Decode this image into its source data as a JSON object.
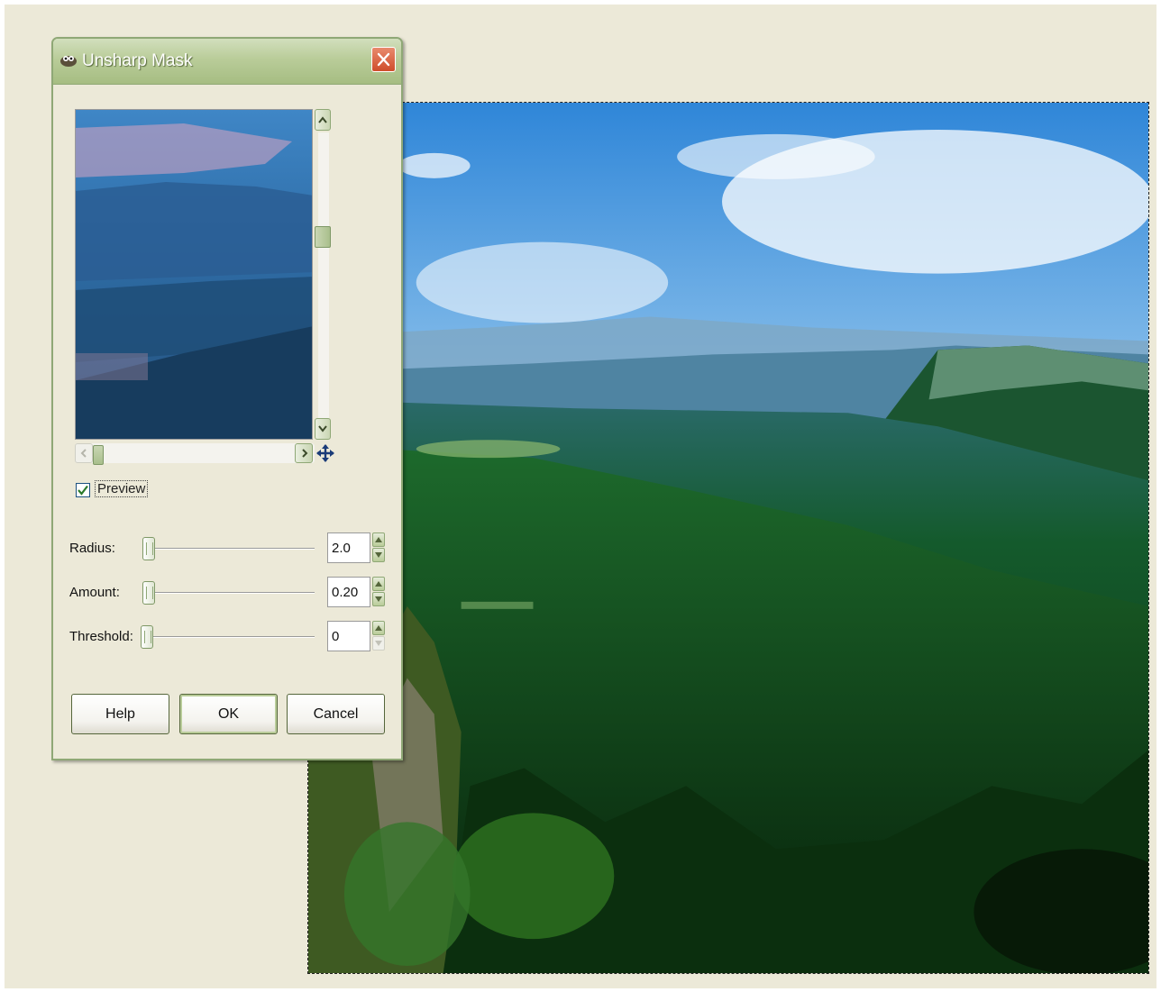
{
  "dialog": {
    "title": "Unsharp Mask",
    "preview_label": "Preview",
    "preview_checked": true
  },
  "params": {
    "radius": {
      "label": "Radius:",
      "value": "2.0"
    },
    "amount": {
      "label": "Amount:",
      "value": "0.20"
    },
    "threshold": {
      "label": "Threshold:",
      "value": "0"
    }
  },
  "buttons": {
    "help": "Help",
    "ok": "OK",
    "cancel": "Cancel"
  },
  "theme": {
    "titlebar": "#b9cc99",
    "close": "#cf4d2b",
    "workspace_bg": "#ece9d8"
  }
}
